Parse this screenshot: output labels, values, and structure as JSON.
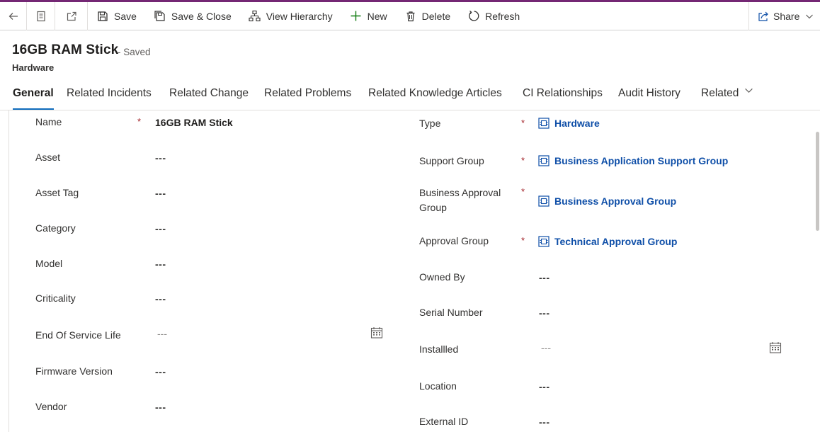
{
  "command_bar": {
    "save": "Save",
    "save_close": "Save & Close",
    "view_hierarchy": "View Hierarchy",
    "new": "New",
    "delete": "Delete",
    "refresh": "Refresh",
    "share": "Share"
  },
  "header": {
    "title": "16GB RAM Stick",
    "status": "- Saved",
    "entity": "Hardware"
  },
  "tabs": [
    {
      "label": "General"
    },
    {
      "label": "Related Incidents"
    },
    {
      "label": "Related Change"
    },
    {
      "label": "Related Problems"
    },
    {
      "label": "Related Knowledge Articles"
    },
    {
      "label": "CI Relationships"
    },
    {
      "label": "Audit History"
    },
    {
      "label": "Related"
    }
  ],
  "left_fields": [
    {
      "label": "Name",
      "value": "16GB RAM Stick"
    },
    {
      "label": "Asset",
      "value": "---"
    },
    {
      "label": "Asset Tag",
      "value": "---"
    },
    {
      "label": "Category",
      "value": "---"
    },
    {
      "label": "Model",
      "value": "---"
    },
    {
      "label": "Criticality",
      "value": "---"
    },
    {
      "label": "End Of Service Life",
      "value": "---"
    },
    {
      "label": "Firmware Version",
      "value": "---"
    },
    {
      "label": "Vendor",
      "value": "---"
    }
  ],
  "right_fields": [
    {
      "label": "Type",
      "value": "Hardware"
    },
    {
      "label": "Support Group",
      "value": "Business Application Support Group"
    },
    {
      "label": "Business Approval Group",
      "value": "Business Approval Group"
    },
    {
      "label": "Approval Group",
      "value": "Technical Approval Group"
    },
    {
      "label": "Owned By",
      "value": "---"
    },
    {
      "label": "Serial Number",
      "value": "---"
    },
    {
      "label": "Installled",
      "value": "---"
    },
    {
      "label": "Location",
      "value": "---"
    },
    {
      "label": "External ID",
      "value": "---"
    }
  ],
  "required_mark": "*",
  "colors": {
    "accent": "#742774",
    "link": "#0f4fa8",
    "required": "#a4262c",
    "tab_indicator": "#0f6cbd"
  },
  "icons": [
    "back-arrow-icon",
    "form-icon",
    "popout-icon",
    "save-icon",
    "save-close-icon",
    "hierarchy-icon",
    "plus-icon",
    "trash-icon",
    "refresh-icon",
    "share-icon",
    "chevron-down-icon",
    "calendar-icon",
    "lookup-entity-icon"
  ]
}
